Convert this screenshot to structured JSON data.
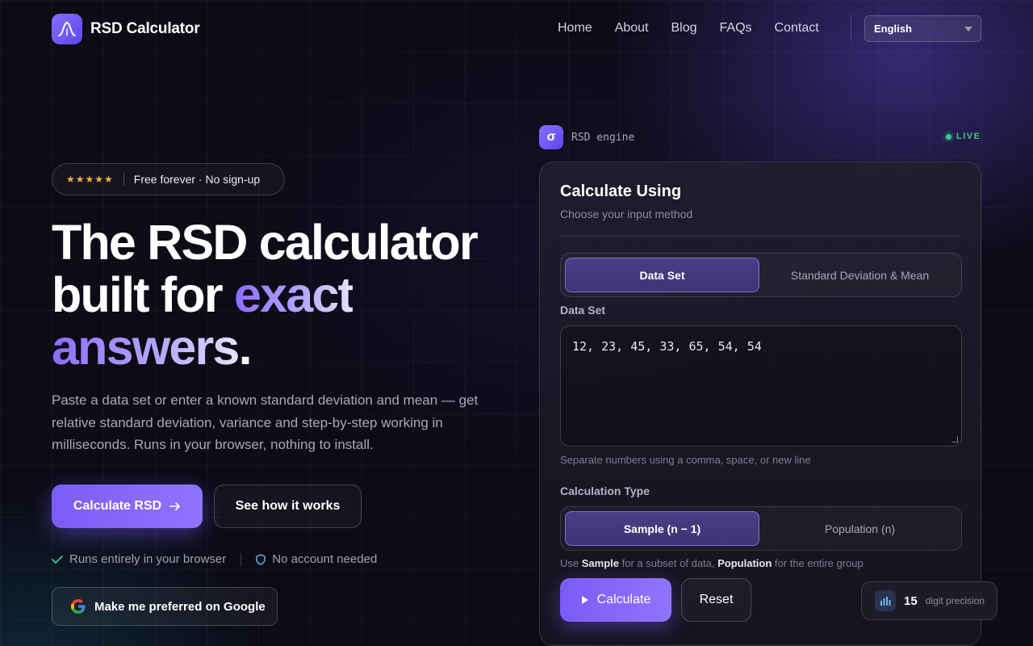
{
  "brand": {
    "name": "RSD Calculator"
  },
  "nav": {
    "items": [
      "Home",
      "About",
      "Blog",
      "FAQs",
      "Contact"
    ],
    "language": "English"
  },
  "hero": {
    "rating_stars": "★★★★★",
    "badge_text": "Free forever · No sign-up",
    "title_line1": "The RSD calculator",
    "title_line2_plain": "built for ",
    "title_line2_accent": "exact",
    "title_line3_accent": "answers",
    "title_line3_end": ".",
    "description": "Paste a data set or enter a known standard deviation and mean — get relative standard deviation, variance and step-by-step working in milliseconds. Runs in your browser, nothing to install.",
    "primary_cta": "Calculate RSD",
    "secondary_cta": "See how it works",
    "trust_1": "Runs entirely in your browser",
    "trust_2": "No account needed",
    "google_cta": "Make me preferred on Google"
  },
  "engine": {
    "mark": "σ",
    "label": "RSD engine",
    "status": "LIVE"
  },
  "calculator": {
    "title": "Calculate Using",
    "subtitle": "Choose your input method",
    "method_options": [
      "Data Set",
      "Standard Deviation & Mean"
    ],
    "selected_method": "Data Set",
    "data_label": "Data Set",
    "data_value": "12, 23, 45, 33, 65, 54, 54",
    "data_hint": "Separate numbers using a comma, space, or new line",
    "type_label": "Calculation Type",
    "type_options": [
      "Sample (n − 1)",
      "Population (n)"
    ],
    "selected_type": "Sample (n − 1)",
    "type_hint_use": "Use ",
    "type_hint_sample": "Sample",
    "type_hint_mid": " for a subset of data, ",
    "type_hint_population": "Population",
    "type_hint_end": " for the entire group",
    "calculate_label": "Calculate",
    "reset_label": "Reset"
  },
  "precision": {
    "value": "15",
    "label": "digit precision"
  }
}
